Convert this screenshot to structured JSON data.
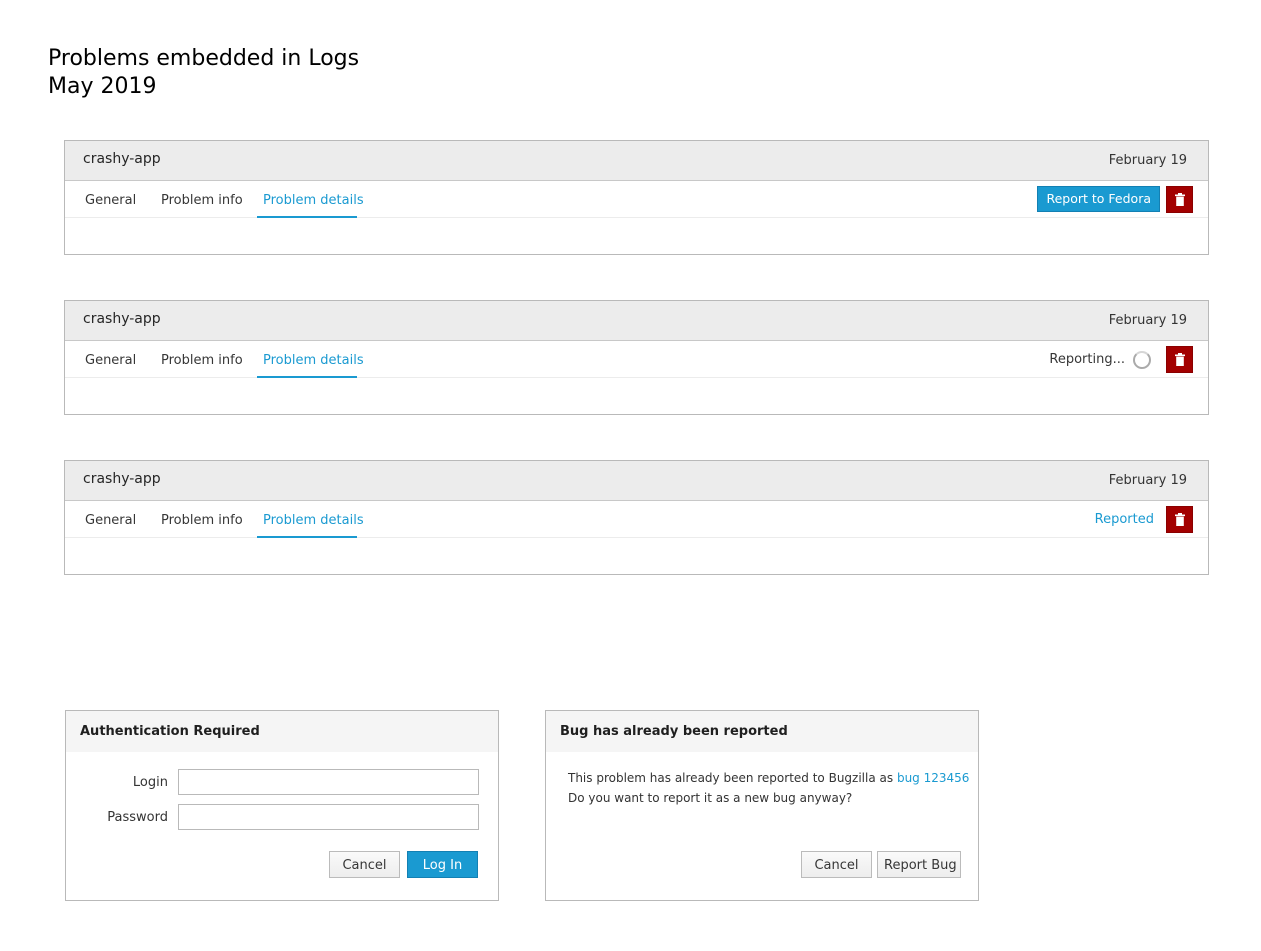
{
  "heading": {
    "line1": "Problems embedded in Logs",
    "line2": "May 2019"
  },
  "cards": [
    {
      "title": "crashy-app",
      "date": "February 19",
      "tabs": [
        "General",
        "Problem info",
        "Problem details"
      ],
      "active_tab": "Problem details",
      "state": "not-reported",
      "report_button_label": "Report to Fedora"
    },
    {
      "title": "crashy-app",
      "date": "February 19",
      "tabs": [
        "General",
        "Problem info",
        "Problem details"
      ],
      "active_tab": "Problem details",
      "state": "reporting",
      "reporting_label": "Reporting..."
    },
    {
      "title": "crashy-app",
      "date": "February 19",
      "tabs": [
        "General",
        "Problem info",
        "Problem details"
      ],
      "active_tab": "Problem details",
      "state": "reported",
      "reported_label": "Reported"
    }
  ],
  "auth_dialog": {
    "title": "Authentication Required",
    "login_label": "Login",
    "password_label": "Password",
    "login_value": "",
    "password_value": "",
    "cancel_label": "Cancel",
    "submit_label": "Log In"
  },
  "bug_dialog": {
    "title": "Bug has already been reported",
    "message_prefix": "This problem has already been reported to Bugzilla as",
    "bug_link": "bug 123456",
    "message_line2": "Do you want to report it as a new bug anyway?",
    "cancel_label": "Cancel",
    "report_label": "Report Bug"
  },
  "colors": {
    "accent": "#1a9ad1",
    "danger": "#a30000",
    "header_bg": "#ececec",
    "border": "#b9b9b9"
  },
  "icons": {
    "delete": "trash-icon",
    "reporting": "spinner-icon"
  }
}
